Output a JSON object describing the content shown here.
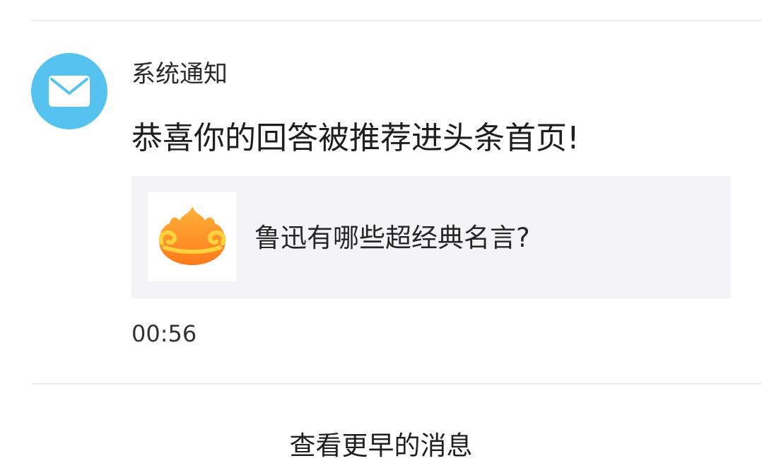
{
  "notification": {
    "sender": "系统通知",
    "icon": "mail-icon",
    "avatar_color": "#56c2ee",
    "headline": "恭喜你的回答被推荐进头条首页!",
    "card": {
      "thumbnail_icon": "flame-logo-icon",
      "question": "鲁迅有哪些超经典名言?"
    },
    "time": "00:56"
  },
  "footer": {
    "more_label": "查看更早的消息"
  }
}
